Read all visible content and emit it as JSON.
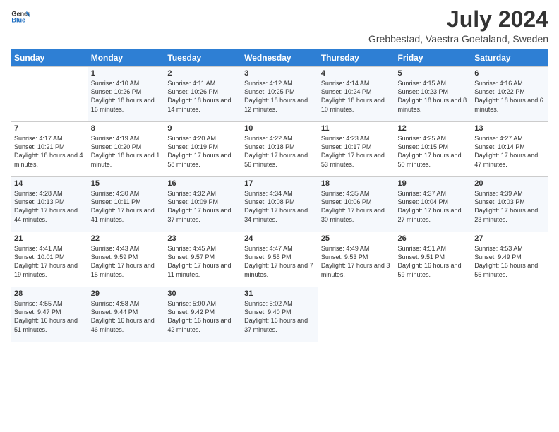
{
  "logo": {
    "line1": "General",
    "line2": "Blue"
  },
  "title": "July 2024",
  "subtitle": "Grebbestad, Vaestra Goetaland, Sweden",
  "days_header": [
    "Sunday",
    "Monday",
    "Tuesday",
    "Wednesday",
    "Thursday",
    "Friday",
    "Saturday"
  ],
  "weeks": [
    [
      {
        "day": "",
        "content": ""
      },
      {
        "day": "1",
        "content": "Sunrise: 4:10 AM\nSunset: 10:26 PM\nDaylight: 18 hours\nand 16 minutes."
      },
      {
        "day": "2",
        "content": "Sunrise: 4:11 AM\nSunset: 10:26 PM\nDaylight: 18 hours\nand 14 minutes."
      },
      {
        "day": "3",
        "content": "Sunrise: 4:12 AM\nSunset: 10:25 PM\nDaylight: 18 hours\nand 12 minutes."
      },
      {
        "day": "4",
        "content": "Sunrise: 4:14 AM\nSunset: 10:24 PM\nDaylight: 18 hours\nand 10 minutes."
      },
      {
        "day": "5",
        "content": "Sunrise: 4:15 AM\nSunset: 10:23 PM\nDaylight: 18 hours\nand 8 minutes."
      },
      {
        "day": "6",
        "content": "Sunrise: 4:16 AM\nSunset: 10:22 PM\nDaylight: 18 hours\nand 6 minutes."
      }
    ],
    [
      {
        "day": "7",
        "content": "Sunrise: 4:17 AM\nSunset: 10:21 PM\nDaylight: 18 hours\nand 4 minutes."
      },
      {
        "day": "8",
        "content": "Sunrise: 4:19 AM\nSunset: 10:20 PM\nDaylight: 18 hours\nand 1 minute."
      },
      {
        "day": "9",
        "content": "Sunrise: 4:20 AM\nSunset: 10:19 PM\nDaylight: 17 hours\nand 58 minutes."
      },
      {
        "day": "10",
        "content": "Sunrise: 4:22 AM\nSunset: 10:18 PM\nDaylight: 17 hours\nand 56 minutes."
      },
      {
        "day": "11",
        "content": "Sunrise: 4:23 AM\nSunset: 10:17 PM\nDaylight: 17 hours\nand 53 minutes."
      },
      {
        "day": "12",
        "content": "Sunrise: 4:25 AM\nSunset: 10:15 PM\nDaylight: 17 hours\nand 50 minutes."
      },
      {
        "day": "13",
        "content": "Sunrise: 4:27 AM\nSunset: 10:14 PM\nDaylight: 17 hours\nand 47 minutes."
      }
    ],
    [
      {
        "day": "14",
        "content": "Sunrise: 4:28 AM\nSunset: 10:13 PM\nDaylight: 17 hours\nand 44 minutes."
      },
      {
        "day": "15",
        "content": "Sunrise: 4:30 AM\nSunset: 10:11 PM\nDaylight: 17 hours\nand 41 minutes."
      },
      {
        "day": "16",
        "content": "Sunrise: 4:32 AM\nSunset: 10:09 PM\nDaylight: 17 hours\nand 37 minutes."
      },
      {
        "day": "17",
        "content": "Sunrise: 4:34 AM\nSunset: 10:08 PM\nDaylight: 17 hours\nand 34 minutes."
      },
      {
        "day": "18",
        "content": "Sunrise: 4:35 AM\nSunset: 10:06 PM\nDaylight: 17 hours\nand 30 minutes."
      },
      {
        "day": "19",
        "content": "Sunrise: 4:37 AM\nSunset: 10:04 PM\nDaylight: 17 hours\nand 27 minutes."
      },
      {
        "day": "20",
        "content": "Sunrise: 4:39 AM\nSunset: 10:03 PM\nDaylight: 17 hours\nand 23 minutes."
      }
    ],
    [
      {
        "day": "21",
        "content": "Sunrise: 4:41 AM\nSunset: 10:01 PM\nDaylight: 17 hours\nand 19 minutes."
      },
      {
        "day": "22",
        "content": "Sunrise: 4:43 AM\nSunset: 9:59 PM\nDaylight: 17 hours\nand 15 minutes."
      },
      {
        "day": "23",
        "content": "Sunrise: 4:45 AM\nSunset: 9:57 PM\nDaylight: 17 hours\nand 11 minutes."
      },
      {
        "day": "24",
        "content": "Sunrise: 4:47 AM\nSunset: 9:55 PM\nDaylight: 17 hours\nand 7 minutes."
      },
      {
        "day": "25",
        "content": "Sunrise: 4:49 AM\nSunset: 9:53 PM\nDaylight: 17 hours\nand 3 minutes."
      },
      {
        "day": "26",
        "content": "Sunrise: 4:51 AM\nSunset: 9:51 PM\nDaylight: 16 hours\nand 59 minutes."
      },
      {
        "day": "27",
        "content": "Sunrise: 4:53 AM\nSunset: 9:49 PM\nDaylight: 16 hours\nand 55 minutes."
      }
    ],
    [
      {
        "day": "28",
        "content": "Sunrise: 4:55 AM\nSunset: 9:47 PM\nDaylight: 16 hours\nand 51 minutes."
      },
      {
        "day": "29",
        "content": "Sunrise: 4:58 AM\nSunset: 9:44 PM\nDaylight: 16 hours\nand 46 minutes."
      },
      {
        "day": "30",
        "content": "Sunrise: 5:00 AM\nSunset: 9:42 PM\nDaylight: 16 hours\nand 42 minutes."
      },
      {
        "day": "31",
        "content": "Sunrise: 5:02 AM\nSunset: 9:40 PM\nDaylight: 16 hours\nand 37 minutes."
      },
      {
        "day": "",
        "content": ""
      },
      {
        "day": "",
        "content": ""
      },
      {
        "day": "",
        "content": ""
      }
    ]
  ]
}
